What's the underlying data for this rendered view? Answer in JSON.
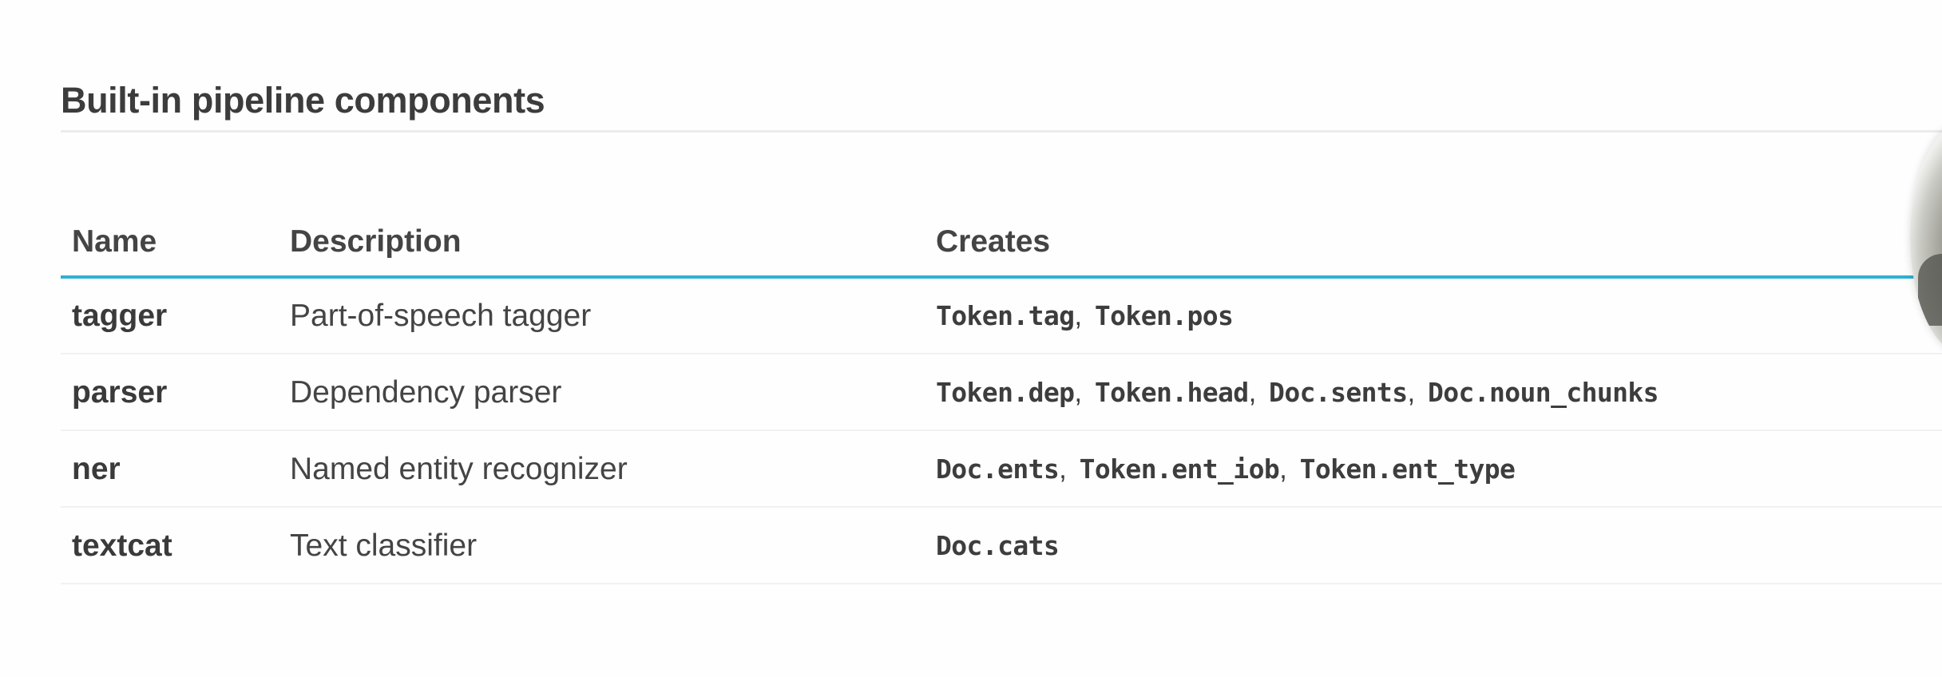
{
  "heading": "Built-in pipeline components",
  "table": {
    "columns": [
      "Name",
      "Description",
      "Creates"
    ],
    "rows": [
      {
        "name": "tagger",
        "description": "Part-of-speech tagger",
        "creates": [
          "Token.tag",
          "Token.pos"
        ]
      },
      {
        "name": "parser",
        "description": "Dependency parser",
        "creates": [
          "Token.dep",
          "Token.head",
          "Doc.sents",
          "Doc.noun_chunks"
        ]
      },
      {
        "name": "ner",
        "description": "Named entity recognizer",
        "creates": [
          "Doc.ents",
          "Token.ent_iob",
          "Token.ent_type"
        ]
      },
      {
        "name": "textcat",
        "description": "Text classifier",
        "creates": [
          "Doc.cats"
        ]
      }
    ]
  },
  "colors": {
    "header_rule": "#2fb1d3",
    "text": "#3d3d3d"
  }
}
